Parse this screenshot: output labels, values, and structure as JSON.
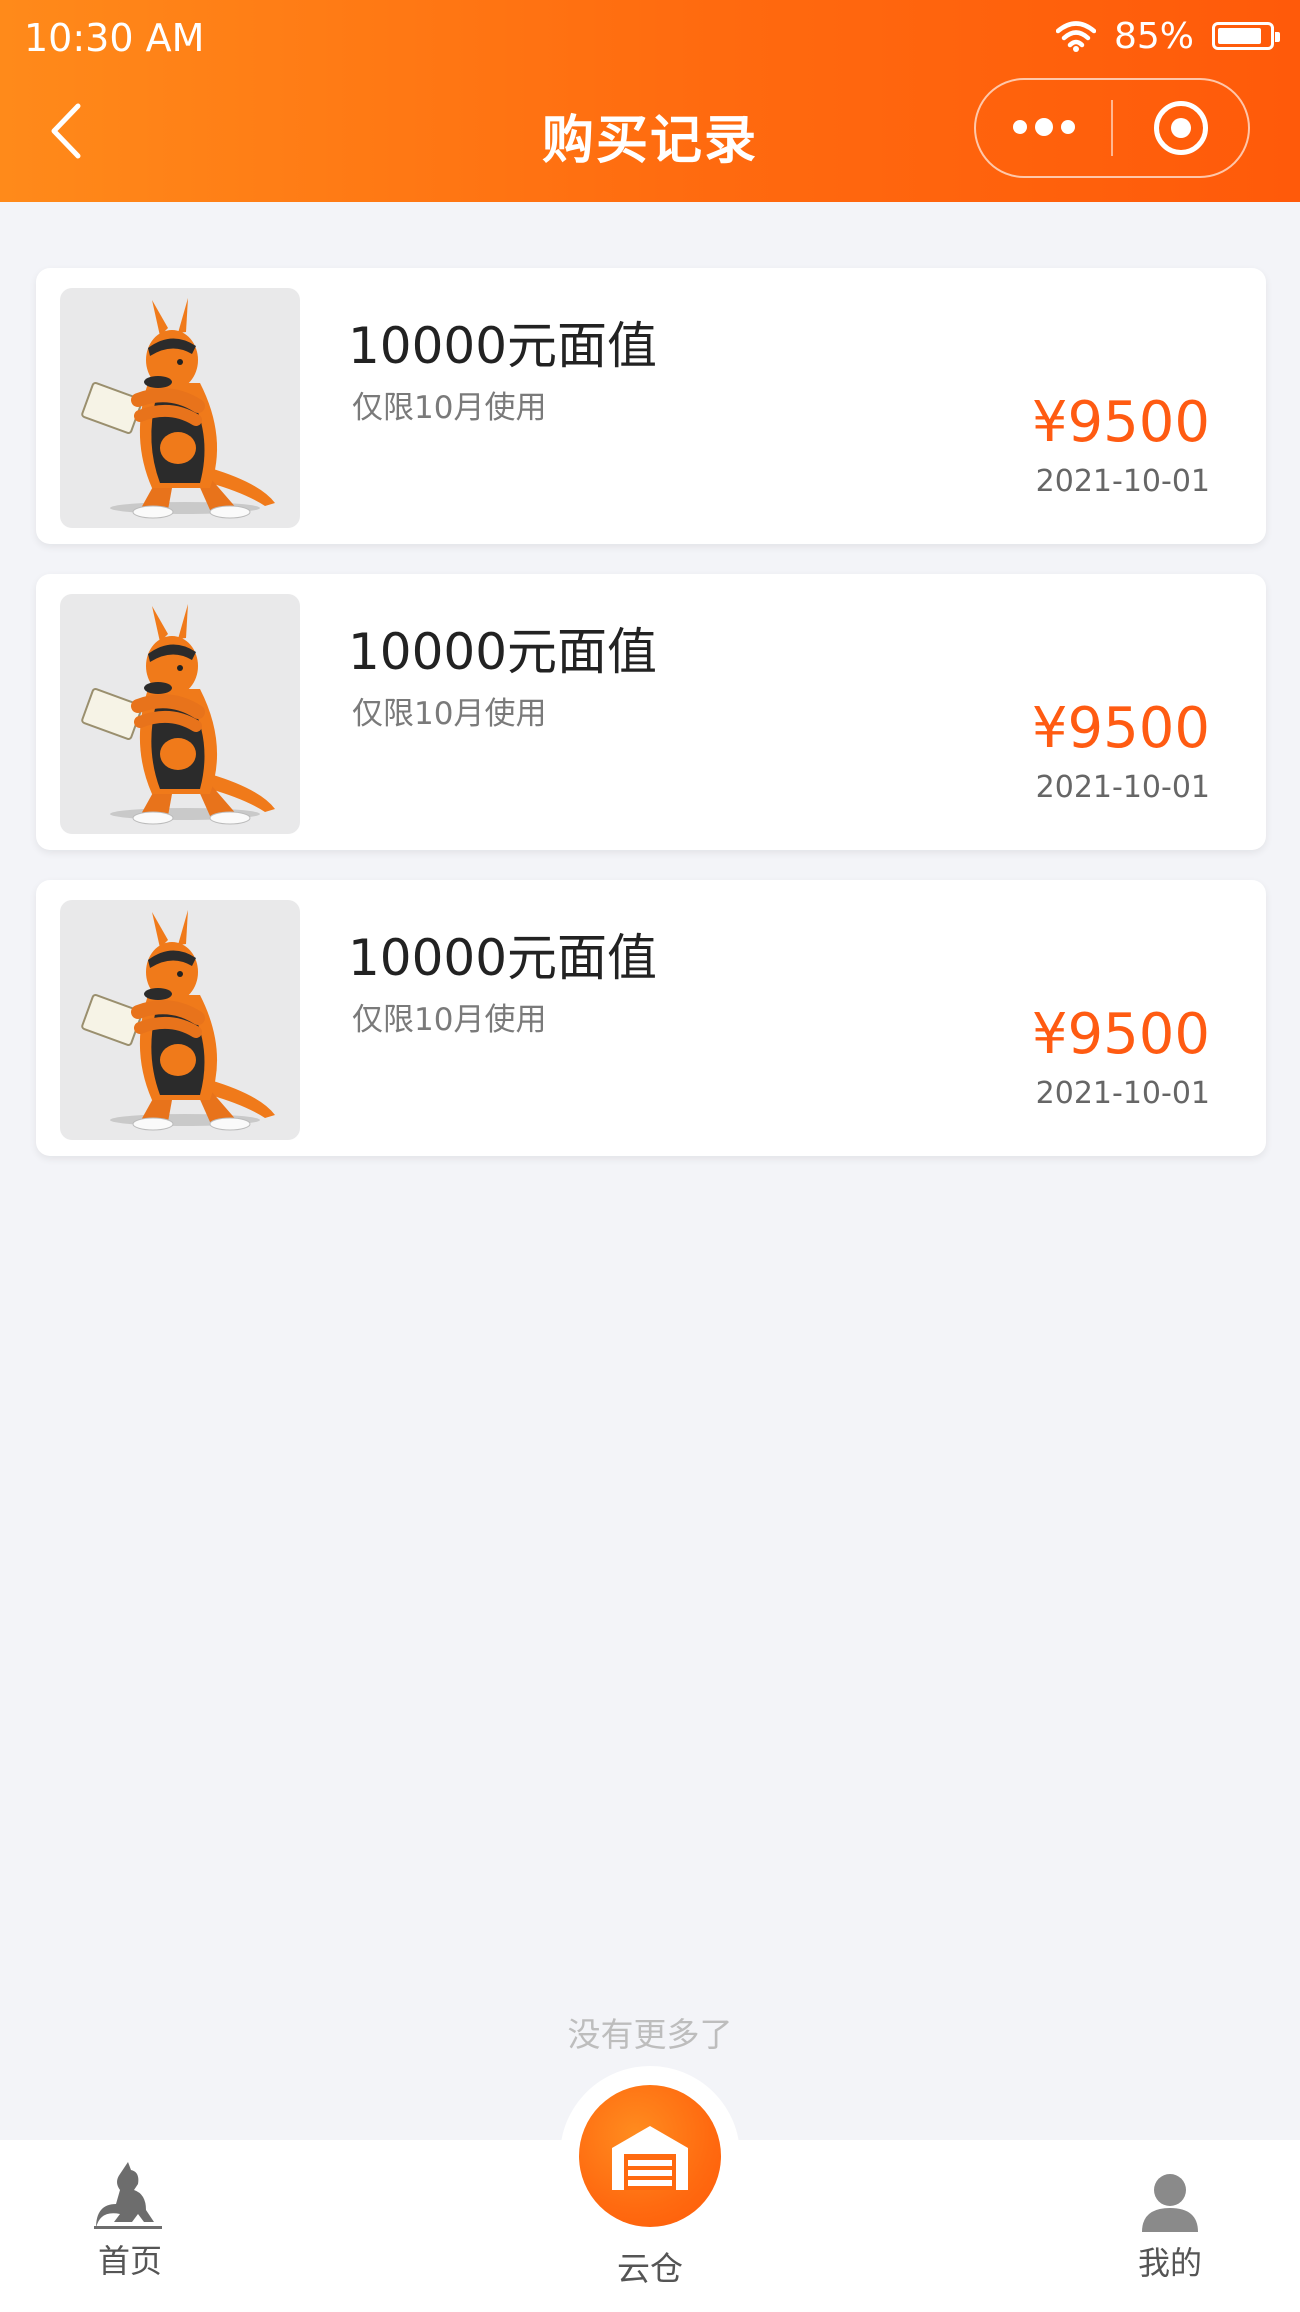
{
  "status": {
    "time": "10:30 AM",
    "battery": "85%",
    "battery_level": 0.85
  },
  "header": {
    "title": "购买记录"
  },
  "records": [
    {
      "title": "10000元面值",
      "note": "仅限10月使用",
      "price": "¥9500",
      "date": "2021-10-01",
      "image": "kangaroo-mascot"
    },
    {
      "title": "10000元面值",
      "note": "仅限10月使用",
      "price": "¥9500",
      "date": "2021-10-01",
      "image": "kangaroo-mascot"
    },
    {
      "title": "10000元面值",
      "note": "仅限10月使用",
      "price": "¥9500",
      "date": "2021-10-01",
      "image": "kangaroo-mascot"
    }
  ],
  "footer_text": "没有更多了",
  "tabbar": {
    "home": "首页",
    "warehouse": "云仓",
    "mine": "我的"
  },
  "colors": {
    "accent": "#ff6a0f",
    "price": "#ff5b12",
    "background": "#f3f4f8"
  }
}
